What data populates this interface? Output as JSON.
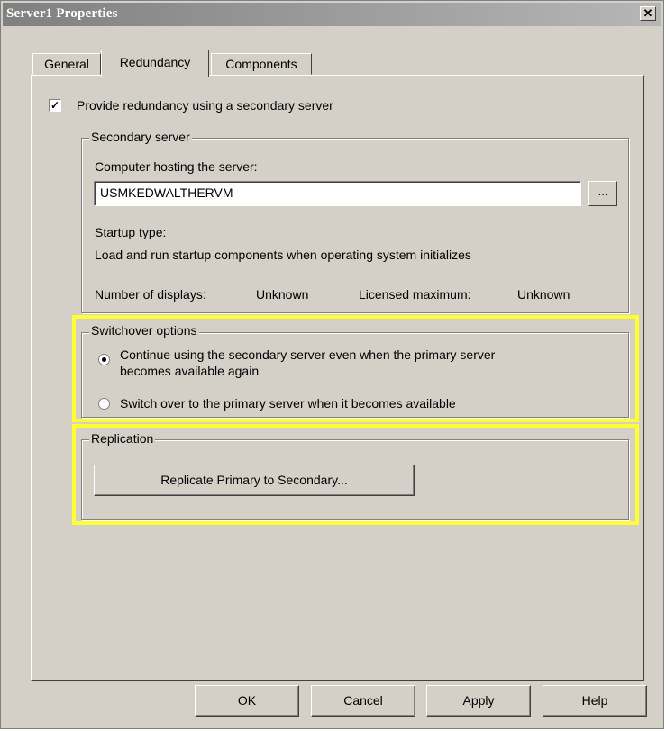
{
  "window": {
    "title": "Server1 Properties",
    "close_glyph": "✕"
  },
  "tabs": [
    {
      "label": "General",
      "active": false
    },
    {
      "label": "Redundancy",
      "active": true
    },
    {
      "label": "Components",
      "active": false
    }
  ],
  "redundancy": {
    "checkbox_label": "Provide redundancy using a secondary server",
    "checkbox_checked": true,
    "checkbox_mark": "✓"
  },
  "secondary_server": {
    "legend": "Secondary server",
    "host_label": "Computer hosting the server:",
    "host_value": "USMKEDWALTHERVM",
    "browse_label": "...",
    "startup_type_label": "Startup type:",
    "startup_type_value": "Load and run startup components when operating system initializes",
    "displays_label": "Number of displays:",
    "displays_value": "Unknown",
    "licensed_label": "Licensed maximum:",
    "licensed_value": "Unknown"
  },
  "switchover": {
    "legend": "Switchover options",
    "option1_line1": "Continue using the secondary server even when the primary server",
    "option1_line2": "becomes available again",
    "option1_selected": true,
    "option2": "Switch over to the primary server when it becomes available",
    "option2_selected": false
  },
  "replication": {
    "legend": "Replication",
    "button_label": "Replicate Primary to Secondary..."
  },
  "footer": {
    "ok": "OK",
    "cancel": "Cancel",
    "apply": "Apply",
    "help": "Help"
  },
  "colors": {
    "highlight": "#ffff33",
    "dialog_bg": "#d4d0c8"
  }
}
